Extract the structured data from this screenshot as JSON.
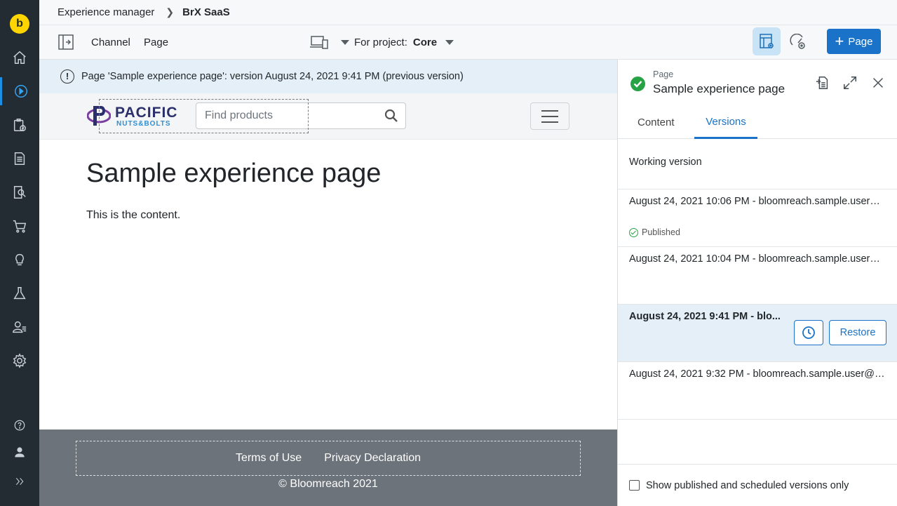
{
  "rail": {
    "logo_letter": "b",
    "items": [
      "home-icon",
      "experience-manager-icon",
      "projects-icon",
      "content-icon",
      "seo-icon",
      "commerce-icon",
      "insights-icon",
      "experiments-icon",
      "audiences-icon",
      "settings-icon",
      "help-icon",
      "user-icon",
      "expand-icon"
    ],
    "active": "experience-manager-icon"
  },
  "breadcrumb": {
    "root": "Experience manager",
    "current": "BrX SaaS"
  },
  "toolbar": {
    "channel_label": "Channel",
    "page_label": "Page",
    "project_label": "For project:",
    "project_value": "Core",
    "add_page_label": "Page"
  },
  "notice": {
    "text": "Page 'Sample experience page': version August 24, 2021 9:41 PM (previous version)"
  },
  "preview": {
    "logo_top": "PACIFIC",
    "logo_bottom": "NUTS&BOLTS",
    "search_placeholder": "Find products",
    "heading": "Sample experience page",
    "body": "This is the content.",
    "footer_links": [
      "Terms of Use",
      "Privacy Declaration"
    ],
    "copyright": "© Bloomreach 2021"
  },
  "panel": {
    "type_label": "Page",
    "title": "Sample experience page",
    "tabs": [
      "Content",
      "Versions"
    ],
    "active_tab": "Versions",
    "versions": [
      {
        "label": "Working version"
      },
      {
        "label": "August 24, 2021 10:06 PM - bloomreach.sample.user@...",
        "status": "Published"
      },
      {
        "label": "August 24, 2021 10:04 PM - bloomreach.sample.user@..."
      },
      {
        "label": "August 24, 2021 9:41 PM - blo...",
        "selected": true,
        "restore_label": "Restore"
      },
      {
        "label": "August 24, 2021 9:32 PM - bloomreach.sample.user@n..."
      }
    ],
    "filter_label": "Show published and scheduled versions only"
  },
  "colors": {
    "rail": "#222c32",
    "accent": "#1a73c8",
    "notice_bg": "#e4eff8",
    "published_green": "#27a244"
  }
}
